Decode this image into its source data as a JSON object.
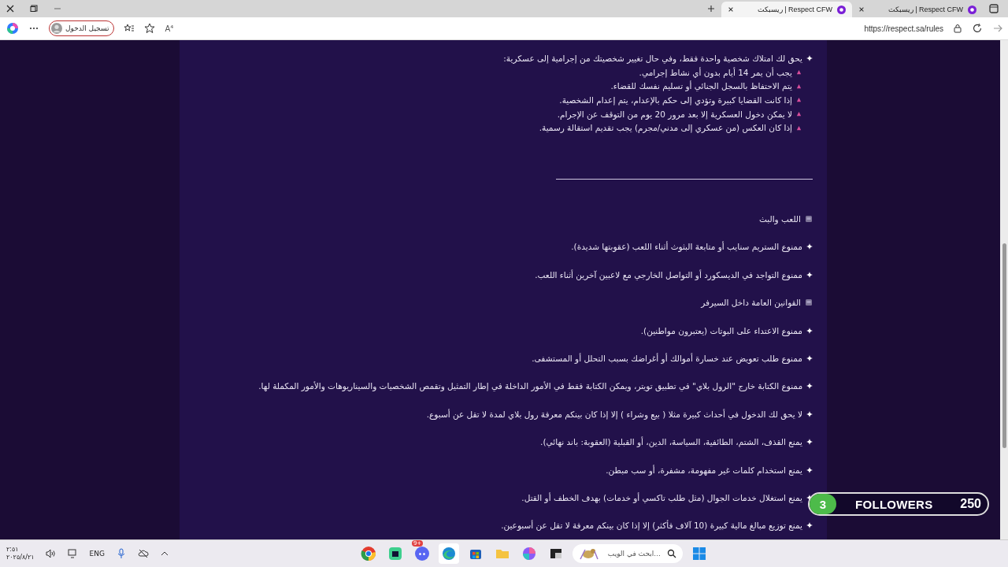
{
  "browser": {
    "tabs": [
      {
        "title": "Respect CFW | ريسبكت",
        "selected": false
      },
      {
        "title": "Respect CFW | ريسبكت",
        "selected": true
      }
    ],
    "url": "https://respect.sa/rules",
    "login_button": "تسجيل الدخول",
    "read_aloud": "A⁴"
  },
  "rules": [
    {
      "kind": "rule",
      "text": "يحق لك امتلاك شخصية واحدة فقط، وفي حال تغيير شخصيتك من إجرامية إلى عسكرية:"
    },
    {
      "kind": "sub",
      "text": "يجب أن يمر 14 أيام بدون أي نشاط إجرامي."
    },
    {
      "kind": "sub",
      "text": "يتم الاحتفاظ بالسجل الجنائي أو تسليم نفسك للقضاء."
    },
    {
      "kind": "sub",
      "text": "إذا كانت القضايا كبيرة وتؤدي إلى حكم بالإعدام، يتم إعدام الشخصية."
    },
    {
      "kind": "sub",
      "text": "لا يمكن دخول العسكرية إلا بعد مرور 20 يوم من التوقف عن الإجرام."
    },
    {
      "kind": "sub",
      "text": "إذا كان العكس (من عسكري إلى مدني/مجرم) يجب تقديم استقالة رسمية."
    },
    {
      "kind": "divider"
    },
    {
      "kind": "heading",
      "text": "اللعب والبث"
    },
    {
      "kind": "rule",
      "text": "ممنوع الستريم سنايب أو متابعة البثوث أثناء اللعب (عقوبتها شديدة)."
    },
    {
      "kind": "rule",
      "text": "ممنوع التواجد في الديسكورد أو التواصل الخارجي مع لاعبين آخرين أثناء اللعب."
    },
    {
      "kind": "heading",
      "text": "القوانين العامة داخل السيرفر"
    },
    {
      "kind": "rule",
      "text": "ممنوع الاعتداء على البوتات (يعتبرون مواطنين)."
    },
    {
      "kind": "rule",
      "text": "ممنوع طلب تعويض عند خسارة أموالك أو أغراضك بسبب التحلل أو المستشفى."
    },
    {
      "kind": "rule",
      "text": "ممنوع الكتابة خارج \"الرول بلاي\" في تطبيق تويتر، ويمكن الكتابة فقط في الأمور الداخلة في إطار التمثيل وتقمص الشخصيات والسيناريوهات والأمور المكملة لها."
    },
    {
      "kind": "rule",
      "text": "لا يحق لك الدخول في أحداث كبيرة مثلا ( بيع وشراء ) إلا إذا كان بينكم معرفة رول بلاي لمدة لا تقل عن أسبوع."
    },
    {
      "kind": "rule",
      "text": "يمنع القذف، الشتم، الطائفية، السياسة، الدين، أو القبلية (العقوبة: باند نهائي)."
    },
    {
      "kind": "rule",
      "text": "يمنع استخدام كلمات غير مفهومة، مشفرة، أو سب مبطن."
    },
    {
      "kind": "rule",
      "text": "يمنع استغلال خدمات الجوال (مثل طلب تاكسي أو خدمات) بهدف الخطف أو القتل."
    },
    {
      "kind": "rule",
      "text": "يمنع توزيع مبالغ مالية كبيرة (10 آلاف فأكثر) إلا إذا كان بينكم معرفة لا تقل عن أسبوعين."
    }
  ],
  "followers_widget": {
    "count": "3",
    "label": "FOLLOWERS",
    "goal": "250"
  },
  "taskbar": {
    "search_placeholder": "ابحث في الويب...",
    "language": "ENG",
    "time": "٢:٥١",
    "date": "٢٠٢٥/٨/٢١",
    "discord_badge": "9+"
  }
}
